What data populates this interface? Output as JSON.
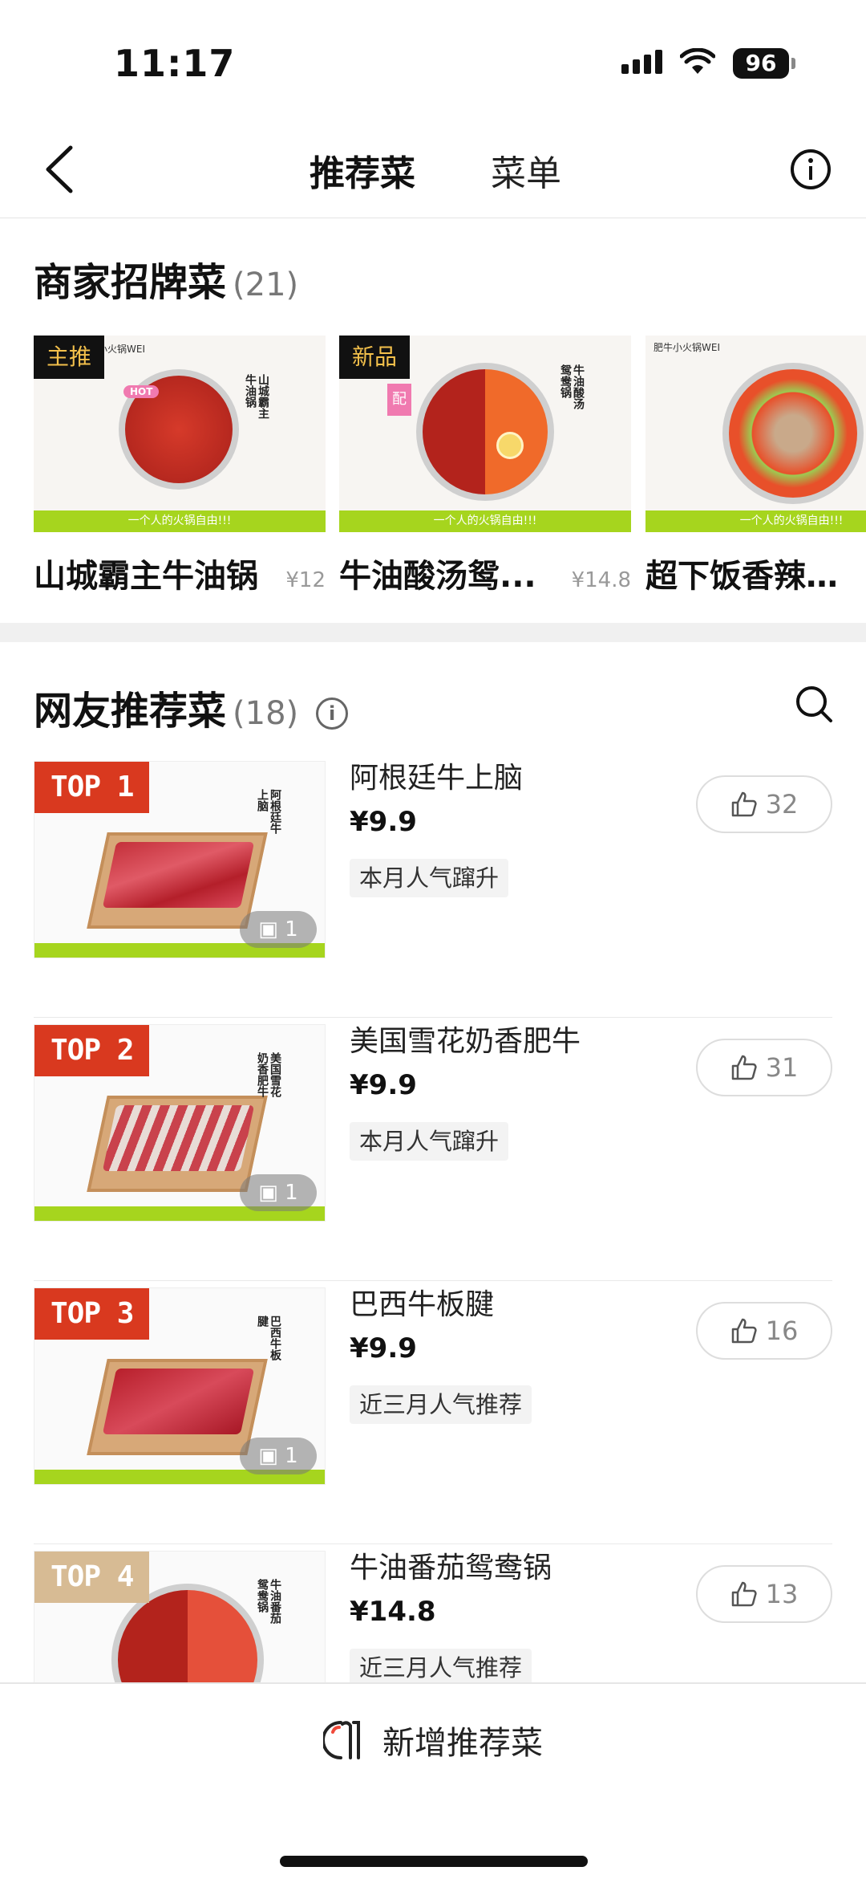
{
  "status": {
    "time": "11:17",
    "battery": "96"
  },
  "nav": {
    "tab_recommended": "推荐菜",
    "tab_menu": "菜单"
  },
  "signature": {
    "title": "商家招牌菜",
    "count": "(21)",
    "items": [
      {
        "name": "山城霸主牛油锅",
        "price": "¥12",
        "tag": "主推",
        "img_text": "山城霸主牛油锅",
        "hot": "HOT",
        "brand": "小火锅WEI",
        "bar_text": "一个人的火锅自由!!!"
      },
      {
        "name": "牛油酸汤鸳...",
        "price": "¥14.8",
        "tag": "新品",
        "img_text": "牛油酸汤鸳鸯锅",
        "side_tag": "配",
        "bar_text": "一个人的火锅自由!!!"
      },
      {
        "name": "超下饭香辣渣...",
        "price": "",
        "tag": "",
        "brand": "肥牛小火锅WEI",
        "bar_text": "一个人的火锅自由!!!"
      }
    ]
  },
  "netizen": {
    "title": "网友推荐菜",
    "count": "(18)",
    "items": [
      {
        "rank": "TOP 1",
        "name": "阿根廷牛上脑",
        "price": "¥9.9",
        "tag": "本月人气蹿升",
        "likes": "32",
        "images": "1",
        "img_text": "阿根廷牛上脑"
      },
      {
        "rank": "TOP 2",
        "name": "美国雪花奶香肥牛",
        "price": "¥9.9",
        "tag": "本月人气蹿升",
        "likes": "31",
        "images": "1",
        "img_text": "美国雪花奶香肥牛"
      },
      {
        "rank": "TOP 3",
        "name": "巴西牛板腱",
        "price": "¥9.9",
        "tag": "近三月人气推荐",
        "likes": "16",
        "images": "1",
        "img_text": "巴西牛板腱"
      },
      {
        "rank": "TOP 4",
        "name": "牛油番茄鸳鸯锅",
        "price": "¥14.8",
        "tag": "近三月人气推荐",
        "likes": "13",
        "images": "",
        "img_text": "牛油番茄鸳鸯锅"
      }
    ]
  },
  "bottom": {
    "add_label": "新增推荐菜"
  },
  "colors": {
    "top_badge": "#d9391f",
    "top4_badge": "#d7bb94",
    "green_bar": "#a6d51e",
    "tag_bg": "#111111",
    "tag_text": "#f3c04b"
  }
}
